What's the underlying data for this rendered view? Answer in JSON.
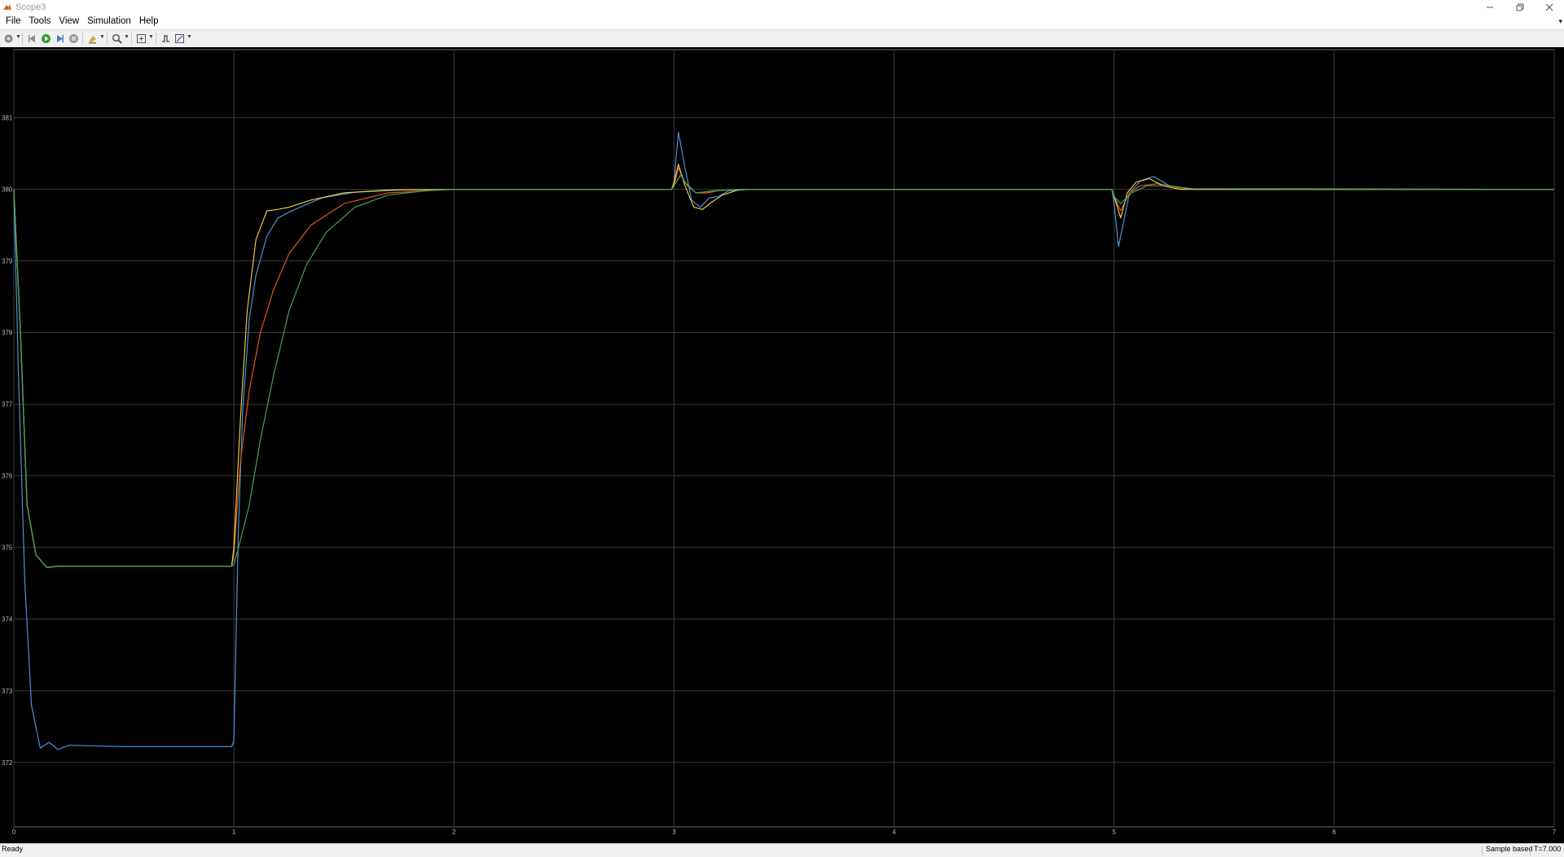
{
  "window": {
    "title": "Scope3",
    "icon": "matlab-logo-icon",
    "controls": [
      "minimize-icon",
      "restore-icon",
      "close-icon"
    ]
  },
  "menu": {
    "items": [
      "File",
      "Tools",
      "View",
      "Simulation",
      "Help"
    ]
  },
  "toolbar": {
    "icons": [
      "settings-icon",
      "step-back-icon",
      "run-icon",
      "step-forward-icon",
      "stop-icon",
      "highlight-icon",
      "zoom-icon",
      "fit-axes-icon",
      "triggers-icon",
      "measurements-icon"
    ]
  },
  "chart_data": {
    "type": "line",
    "title": "",
    "xlabel": "",
    "ylabel": "",
    "xlim": [
      0,
      7
    ],
    "ylim": [
      371.1,
      381.95
    ],
    "grid": true,
    "background": "#000000",
    "xticks": [
      0,
      1,
      2,
      3,
      4,
      5,
      6,
      7
    ],
    "yticks": [
      372,
      373,
      374,
      375,
      376,
      377,
      378,
      379,
      380,
      381
    ],
    "series": [
      {
        "color": "#4a90d9",
        "points": [
          [
            0,
            380
          ],
          [
            0.02,
            377.5
          ],
          [
            0.05,
            374.5
          ],
          [
            0.08,
            372.8
          ],
          [
            0.12,
            372.2
          ],
          [
            0.16,
            372.28
          ],
          [
            0.2,
            372.18
          ],
          [
            0.25,
            372.24
          ],
          [
            0.5,
            372.22
          ],
          [
            0.99,
            372.22
          ],
          [
            1.0,
            372.3
          ],
          [
            1.02,
            375.2
          ],
          [
            1.04,
            376.9
          ],
          [
            1.07,
            378.2
          ],
          [
            1.1,
            378.8
          ],
          [
            1.15,
            379.35
          ],
          [
            1.2,
            379.6
          ],
          [
            1.25,
            379.68
          ],
          [
            1.3,
            379.75
          ],
          [
            1.4,
            379.88
          ],
          [
            1.55,
            379.96
          ],
          [
            1.75,
            379.99
          ],
          [
            2.0,
            380.0
          ],
          [
            2.99,
            380.0
          ],
          [
            3.0,
            380.1
          ],
          [
            3.02,
            380.8
          ],
          [
            3.05,
            380.3
          ],
          [
            3.08,
            379.85
          ],
          [
            3.12,
            379.75
          ],
          [
            3.16,
            379.88
          ],
          [
            3.2,
            379.9
          ],
          [
            3.25,
            379.98
          ],
          [
            3.35,
            380.0
          ],
          [
            4.99,
            380.0
          ],
          [
            5.0,
            379.8
          ],
          [
            5.02,
            379.2
          ],
          [
            5.04,
            379.5
          ],
          [
            5.07,
            379.95
          ],
          [
            5.12,
            380.12
          ],
          [
            5.18,
            380.18
          ],
          [
            5.25,
            380.05
          ],
          [
            5.35,
            380.0
          ],
          [
            7,
            380.0
          ]
        ]
      },
      {
        "color": "#e2541b",
        "points": [
          [
            0,
            380
          ],
          [
            0.03,
            378.0
          ],
          [
            0.06,
            375.6
          ],
          [
            0.1,
            374.9
          ],
          [
            0.15,
            374.72
          ],
          [
            0.2,
            374.74
          ],
          [
            0.5,
            374.74
          ],
          [
            0.99,
            374.74
          ],
          [
            1.0,
            374.9
          ],
          [
            1.03,
            376.2
          ],
          [
            1.07,
            377.2
          ],
          [
            1.12,
            378.0
          ],
          [
            1.18,
            378.6
          ],
          [
            1.25,
            379.1
          ],
          [
            1.35,
            379.5
          ],
          [
            1.5,
            379.8
          ],
          [
            1.7,
            379.95
          ],
          [
            2.0,
            380.0
          ],
          [
            2.99,
            380.0
          ],
          [
            3.0,
            380.05
          ],
          [
            3.02,
            380.3
          ],
          [
            3.05,
            380.1
          ],
          [
            3.1,
            379.95
          ],
          [
            3.15,
            379.95
          ],
          [
            3.2,
            379.98
          ],
          [
            3.3,
            380.0
          ],
          [
            4.99,
            380.0
          ],
          [
            5.0,
            379.9
          ],
          [
            5.03,
            379.7
          ],
          [
            5.07,
            379.95
          ],
          [
            5.12,
            380.05
          ],
          [
            5.2,
            380.08
          ],
          [
            5.3,
            380.02
          ],
          [
            5.4,
            380.0
          ],
          [
            7,
            380.0
          ]
        ]
      },
      {
        "color": "#e8c83a",
        "points": [
          [
            0,
            380
          ],
          [
            0.03,
            378.0
          ],
          [
            0.06,
            375.6
          ],
          [
            0.1,
            374.9
          ],
          [
            0.15,
            374.72
          ],
          [
            0.2,
            374.74
          ],
          [
            0.5,
            374.74
          ],
          [
            0.99,
            374.74
          ],
          [
            1.0,
            375.0
          ],
          [
            1.03,
            376.8
          ],
          [
            1.06,
            378.3
          ],
          [
            1.1,
            379.3
          ],
          [
            1.15,
            379.7
          ],
          [
            1.2,
            379.72
          ],
          [
            1.25,
            379.75
          ],
          [
            1.35,
            379.85
          ],
          [
            1.5,
            379.95
          ],
          [
            1.7,
            379.99
          ],
          [
            2.0,
            380.0
          ],
          [
            2.99,
            380.0
          ],
          [
            3.0,
            380.1
          ],
          [
            3.02,
            380.35
          ],
          [
            3.05,
            380.05
          ],
          [
            3.09,
            379.75
          ],
          [
            3.13,
            379.72
          ],
          [
            3.17,
            379.82
          ],
          [
            3.22,
            379.92
          ],
          [
            3.3,
            380.0
          ],
          [
            4.99,
            380.0
          ],
          [
            5.0,
            379.9
          ],
          [
            5.03,
            379.6
          ],
          [
            5.06,
            379.95
          ],
          [
            5.1,
            380.1
          ],
          [
            5.16,
            380.15
          ],
          [
            5.22,
            380.05
          ],
          [
            5.3,
            380.0
          ],
          [
            7,
            380.0
          ]
        ]
      },
      {
        "color": "#3ea55a",
        "points": [
          [
            0,
            380
          ],
          [
            0.03,
            378.0
          ],
          [
            0.06,
            375.6
          ],
          [
            0.1,
            374.9
          ],
          [
            0.15,
            374.72
          ],
          [
            0.2,
            374.74
          ],
          [
            0.5,
            374.74
          ],
          [
            0.99,
            374.74
          ],
          [
            1.0,
            374.76
          ],
          [
            1.03,
            375.1
          ],
          [
            1.07,
            375.6
          ],
          [
            1.12,
            376.5
          ],
          [
            1.18,
            377.4
          ],
          [
            1.25,
            378.3
          ],
          [
            1.33,
            378.95
          ],
          [
            1.42,
            379.4
          ],
          [
            1.55,
            379.75
          ],
          [
            1.7,
            379.92
          ],
          [
            1.9,
            379.99
          ],
          [
            2.0,
            380.0
          ],
          [
            2.99,
            380.0
          ],
          [
            3.0,
            380.05
          ],
          [
            3.03,
            380.2
          ],
          [
            3.06,
            380.05
          ],
          [
            3.1,
            379.95
          ],
          [
            3.18,
            379.98
          ],
          [
            3.3,
            380.0
          ],
          [
            4.99,
            380.0
          ],
          [
            5.0,
            379.9
          ],
          [
            5.03,
            379.8
          ],
          [
            5.08,
            379.95
          ],
          [
            5.15,
            380.05
          ],
          [
            5.25,
            380.05
          ],
          [
            5.35,
            380.01
          ],
          [
            7,
            380.0
          ]
        ]
      }
    ]
  },
  "status": {
    "text": "Ready",
    "mode": "Sample based",
    "time": "T=7.000"
  }
}
